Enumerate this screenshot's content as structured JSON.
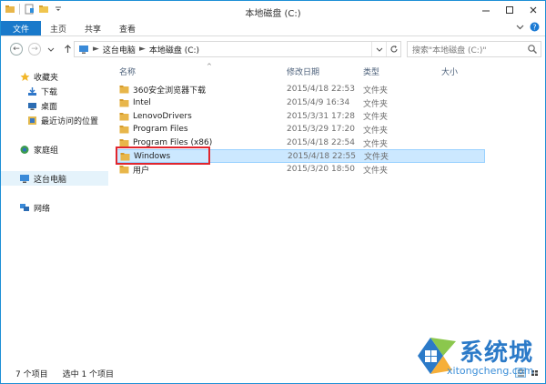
{
  "window": {
    "title": "本地磁盘 (C:)"
  },
  "ribbon": {
    "tabs": [
      "文件",
      "主页",
      "共享",
      "查看"
    ]
  },
  "address": {
    "crumbs": [
      "这台电脑",
      "本地磁盘 (C:)"
    ]
  },
  "search": {
    "placeholder": "搜索\"本地磁盘 (C:)\""
  },
  "navpane": {
    "favorites": {
      "label": "收藏夹",
      "items": [
        "下载",
        "桌面",
        "最近访问的位置"
      ]
    },
    "homegroup": "家庭组",
    "thispc": "这台电脑",
    "network": "网络"
  },
  "columns": {
    "name": "名称",
    "date": "修改日期",
    "type": "类型",
    "size": "大小"
  },
  "files": [
    {
      "name": "360安全浏览器下载",
      "date": "2015/4/18 22:53",
      "type": "文件夹"
    },
    {
      "name": "Intel",
      "date": "2015/4/9 16:34",
      "type": "文件夹"
    },
    {
      "name": "LenovoDrivers",
      "date": "2015/3/31 17:28",
      "type": "文件夹"
    },
    {
      "name": "Program Files",
      "date": "2015/3/29 17:20",
      "type": "文件夹"
    },
    {
      "name": "Program Files (x86)",
      "date": "2015/4/18 22:54",
      "type": "文件夹"
    },
    {
      "name": "Windows",
      "date": "2015/4/18 22:55",
      "type": "文件夹",
      "selected": true
    },
    {
      "name": "用户",
      "date": "2015/3/20 18:50",
      "type": "文件夹"
    }
  ],
  "status": {
    "count": "7 个项目",
    "selected": "选中 1 个项目"
  },
  "watermark": {
    "title": "系统城",
    "url": "xitongcheng.com"
  },
  "colors": {
    "accent": "#1979ca",
    "selection": "#cce8ff",
    "highlight_box": "#e0262e",
    "folder": "#e8b64a"
  }
}
